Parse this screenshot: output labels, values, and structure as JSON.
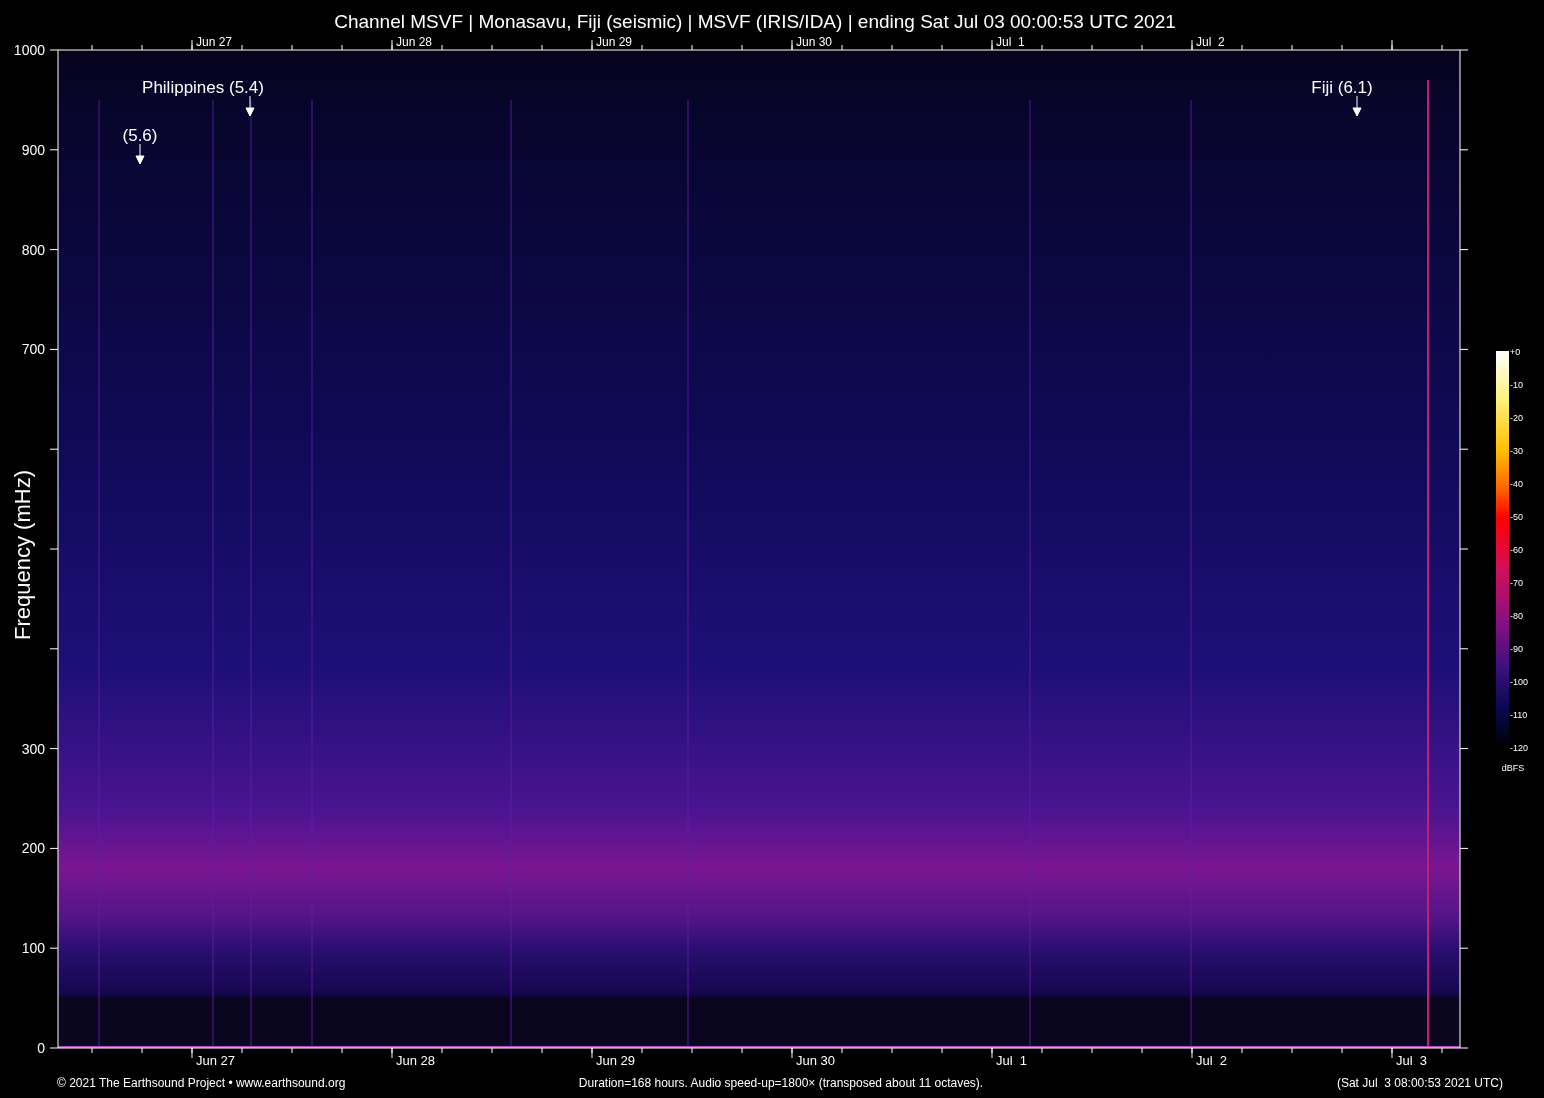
{
  "title": "Channel MSVF | Monasavu, Fiji (seismic) | MSVF (IRIS/IDA) | ending Sat Jul 03 00:00:53 UTC 2021",
  "y_axis": {
    "label": "Frequency (mHz)",
    "ticks": [
      "1000",
      "900",
      "800",
      "700",
      "300",
      "200",
      "100",
      "0"
    ]
  },
  "top_axis": {
    "ticks": [
      "Jun 27",
      "Jun 28",
      "Jun 29",
      "Jun 30",
      "Jul  1",
      "Jul  2"
    ]
  },
  "bottom_axis": {
    "ticks": [
      "Jun 27",
      "Jun 28",
      "Jun 29",
      "Jun 30",
      "Jul  1",
      "Jul  2",
      "Jul  3"
    ]
  },
  "annotations": [
    {
      "label": "(5.6)"
    },
    {
      "label": "Philippines (5.4)"
    },
    {
      "label": "Fiji (6.1)"
    }
  ],
  "colorbar": {
    "ticks": [
      "+0",
      "-10",
      "-20",
      "-30",
      "-40",
      "-50",
      "-60",
      "-70",
      "-80",
      "-90",
      "-100",
      "-110",
      "-120"
    ],
    "unit": "dBFS"
  },
  "footer": {
    "credit": "© 2021 The Earthsound Project • www.earthsound.org",
    "info": "Duration=168 hours. Audio speed-up=1800× (transposed about 11 octaves).",
    "time": "(Sat Jul  3 08:00:53 2021 UTC)"
  }
}
